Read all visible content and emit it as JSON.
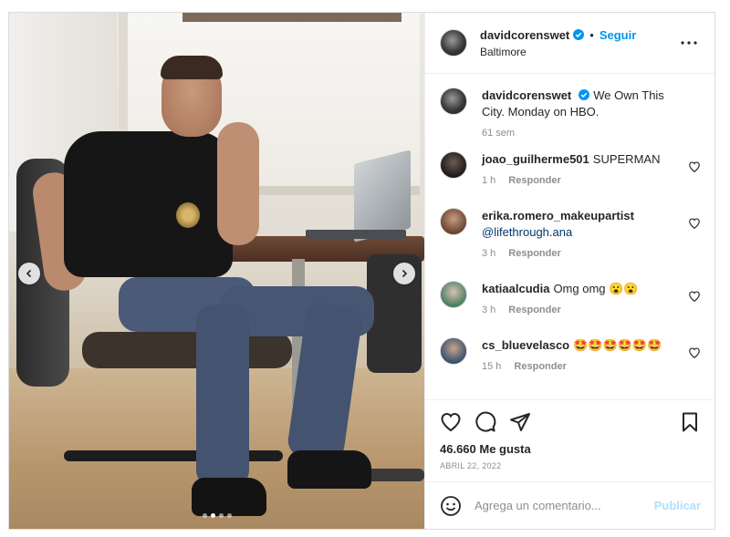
{
  "post": {
    "username": "davidcorenswet",
    "follow_label": "Seguir",
    "dot": "•",
    "location": "Baltimore"
  },
  "caption": {
    "username": "davidcorenswet",
    "text": "We Own This City. Monday on HBO.",
    "time": "61 sem"
  },
  "comments": [
    {
      "username": "joao_guilherme501",
      "text": "SUPERMAN",
      "time": "1 h",
      "reply": "Responder"
    },
    {
      "username": "erika.romero_makeupartist",
      "text": "@lifethrough.ana",
      "time": "3 h",
      "reply": "Responder"
    },
    {
      "username": "katiaalcudia",
      "text": "Omg omg",
      "emoji": [
        "😮",
        "😮"
      ],
      "time": "3 h",
      "reply": "Responder"
    },
    {
      "username": "cs_bluevelasco",
      "text": "",
      "emoji": [
        "🤩",
        "🤩",
        "🤩",
        "🤩",
        "🤩",
        "🤩"
      ],
      "time": "15 h",
      "reply": "Responder"
    }
  ],
  "stats": {
    "likes": "46.660 Me gusta",
    "date": "ABRIL 22, 2022"
  },
  "composer": {
    "placeholder": "Agrega un comentario...",
    "publish_label": "Publicar"
  },
  "carousel": {
    "total": 4,
    "active_index": 1
  },
  "colors": {
    "accent": "#0095f6",
    "publish_disabled": "#b2dffc",
    "muted": "#8e8e8e",
    "text": "#262626",
    "border": "#dbdbdb"
  },
  "icons": {
    "header": [
      "verified-badge-icon",
      "more-options-icon"
    ],
    "media": [
      "chevron-left-icon",
      "chevron-right-icon"
    ],
    "actions": [
      "heart-icon",
      "comment-icon",
      "share-icon",
      "bookmark-icon"
    ],
    "composer": [
      "emoji-icon"
    ]
  }
}
